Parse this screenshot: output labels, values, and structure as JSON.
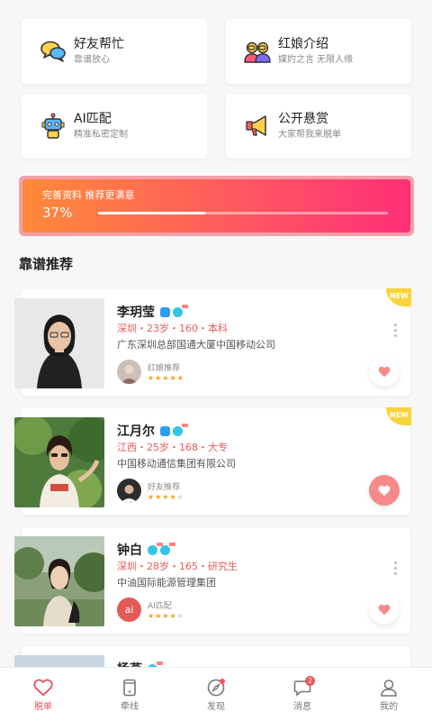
{
  "features": [
    {
      "title": "好友帮忙",
      "subtitle": "靠谱放心",
      "icon": "chat-bubbles-icon"
    },
    {
      "title": "红娘介绍",
      "subtitle": "媒妁之言 无限人缘",
      "icon": "matchmaker-couple-icon"
    },
    {
      "title": "AI匹配",
      "subtitle": "精准私密定制",
      "icon": "robot-icon"
    },
    {
      "title": "公开悬赏",
      "subtitle": "大家帮我来脱单",
      "icon": "megaphone-icon"
    }
  ],
  "profile_banner": {
    "caption": "完善资料 推荐更满意",
    "percent_text": "37%",
    "progress": 0.37
  },
  "section_title": "靠谱推荐",
  "cards": [
    {
      "name": "李玥莹",
      "meta": "深圳・23岁・160・本科",
      "company": "广东深圳总部国通大厦中国移动公司",
      "rec_label": "红娘推荐",
      "stars": 5,
      "is_new": true,
      "new_label": "NEW",
      "liked": false
    },
    {
      "name": "江月尔",
      "meta": "江西・25岁・168・大专",
      "company": "中国移动通信集团有限公司",
      "rec_label": "好友推荐",
      "stars": 4,
      "is_new": true,
      "new_label": "NEW",
      "liked": true
    },
    {
      "name": "钟白",
      "meta": "深圳・28岁・165・研究生",
      "company": "中油国际能源管理集团",
      "rec_label": "AI匹配",
      "stars": 4,
      "is_new": false,
      "liked": false,
      "ai_avatar_text": "ai"
    },
    {
      "name": "杨燕"
    }
  ],
  "tabbar": [
    {
      "label": "脱单",
      "icon": "heart-icon",
      "active": true
    },
    {
      "label": "牵线",
      "icon": "phone-icon"
    },
    {
      "label": "发现",
      "icon": "compass-icon",
      "dot": true
    },
    {
      "label": "消息",
      "icon": "message-icon",
      "count": "2"
    },
    {
      "label": "我的",
      "icon": "person-icon"
    }
  ],
  "colors": {
    "accent": "#e8525a",
    "meta": "#e85a5a",
    "star": "#ff9c1a",
    "new_badge": "#f8d33a"
  }
}
